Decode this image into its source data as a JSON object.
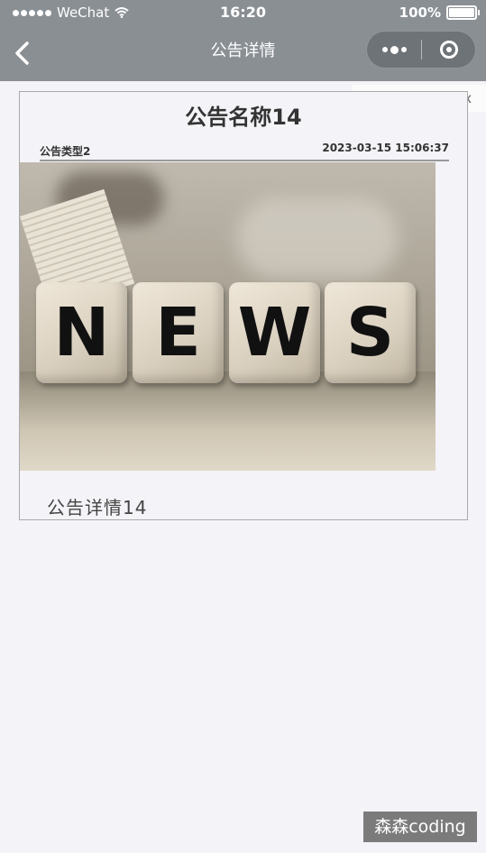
{
  "status_bar": {
    "carrier": "WeChat",
    "time": "16:20",
    "battery": "100%"
  },
  "nav": {
    "title": "公告详情"
  },
  "size_tip": "375px × 603px",
  "notice": {
    "title": "公告名称14",
    "type": "公告类型2",
    "date": "2023-03-15 15:06:37",
    "image_letters": [
      "N",
      "E",
      "W",
      "S"
    ],
    "detail": "公告详情14"
  },
  "watermark": "森森coding",
  "icons": {
    "back": "chevron-left-icon",
    "more": "more-dots-icon",
    "close": "capsule-close-icon",
    "wifi": "wifi-icon",
    "battery": "battery-icon"
  }
}
